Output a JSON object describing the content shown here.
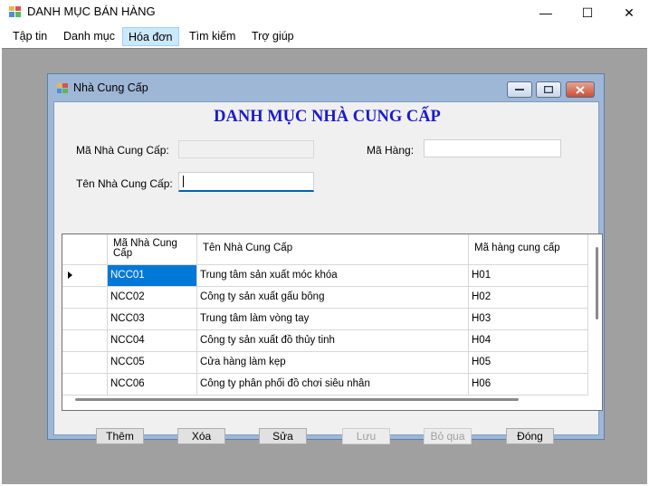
{
  "app": {
    "title": "DANH MỤC BÁN HÀNG",
    "minimize_glyph": "—",
    "maximize_glyph": "☐",
    "close_glyph": "✕"
  },
  "menu": [
    "Tập tin",
    "Danh mục",
    "Hóa đơn",
    "Tìm kiếm",
    "Trợ giúp"
  ],
  "child": {
    "title": "Nhà Cung Cấp",
    "heading": "DANH MỤC NHÀ CUNG CẤP",
    "labels": {
      "ma_ncc": "Mã Nhà Cung Cấp:",
      "ma_hang": "Mã Hàng:",
      "ten_ncc": "Tên Nhà Cung Cấp:"
    },
    "values": {
      "ma_ncc": "",
      "ma_hang": "",
      "ten_ncc": ""
    }
  },
  "grid": {
    "headers": [
      "Mã Nhà Cung Cấp",
      "Tên Nhà Cung Cấp",
      "Mã hàng cung cấp"
    ],
    "rows": [
      [
        "NCC01",
        "Trung tâm sản xuất móc khóa",
        "H01"
      ],
      [
        "NCC02",
        "Công ty sản xuất gấu bông",
        "H02"
      ],
      [
        "NCC03",
        "Trung tâm làm vòng tay",
        "H03"
      ],
      [
        "NCC04",
        "Công ty sản xuất đồ thủy tinh",
        "H04"
      ],
      [
        "NCC05",
        "Cửa hàng làm kẹp",
        "H05"
      ],
      [
        "NCC06",
        "Công ty phân phối đồ chơi siêu nhân",
        "H06"
      ]
    ]
  },
  "buttons": {
    "them": "Thêm",
    "xoa": "Xóa",
    "sua": "Sửa",
    "luu": "Lưu",
    "bo_qua": "Bỏ qua",
    "dong": "Đóng"
  },
  "colors": {
    "heading": "#1a1acc",
    "selection": "#0078d7",
    "mdi_background": "#a0a0a0"
  }
}
